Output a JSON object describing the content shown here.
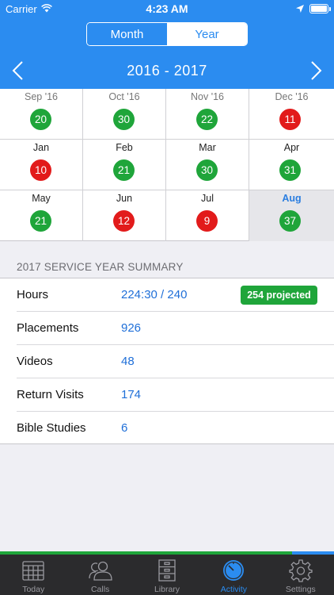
{
  "status_bar": {
    "carrier": "Carrier",
    "time": "4:23 AM"
  },
  "segmented": {
    "options": [
      "Month",
      "Year"
    ],
    "selected": "Year"
  },
  "year_nav": {
    "title": "2016 - 2017"
  },
  "months": [
    {
      "label": "Sep '16",
      "count": "20",
      "status": "green"
    },
    {
      "label": "Oct '16",
      "count": "30",
      "status": "green"
    },
    {
      "label": "Nov '16",
      "count": "22",
      "status": "green"
    },
    {
      "label": "Dec '16",
      "count": "11",
      "status": "red"
    },
    {
      "label": "Jan",
      "count": "10",
      "status": "red"
    },
    {
      "label": "Feb",
      "count": "21",
      "status": "green"
    },
    {
      "label": "Mar",
      "count": "30",
      "status": "green"
    },
    {
      "label": "Apr",
      "count": "31",
      "status": "green"
    },
    {
      "label": "May",
      "count": "21",
      "status": "green"
    },
    {
      "label": "Jun",
      "count": "12",
      "status": "red"
    },
    {
      "label": "Jul",
      "count": "9",
      "status": "red"
    },
    {
      "label": "Aug",
      "count": "37",
      "status": "green",
      "current": true
    }
  ],
  "summary": {
    "header": "2017 SERVICE YEAR SUMMARY",
    "rows": [
      {
        "label": "Hours",
        "value": "224:30 / 240",
        "badge": "254 projected"
      },
      {
        "label": "Placements",
        "value": "926"
      },
      {
        "label": "Videos",
        "value": "48"
      },
      {
        "label": "Return Visits",
        "value": "174"
      },
      {
        "label": "Bible Studies",
        "value": "6"
      }
    ]
  },
  "progress": {
    "fraction": 0.875
  },
  "tabs": [
    {
      "label": "Today",
      "icon": "calendar-icon"
    },
    {
      "label": "Calls",
      "icon": "people-icon"
    },
    {
      "label": "Library",
      "icon": "cabinet-icon"
    },
    {
      "label": "Activity",
      "icon": "stopwatch-icon",
      "active": true
    },
    {
      "label": "Settings",
      "icon": "gear-icon"
    }
  ],
  "colors": {
    "accent": "#2b8cf0",
    "good": "#1fa53a",
    "bad": "#e21b1b",
    "tabbar": "#2b2b2d"
  }
}
